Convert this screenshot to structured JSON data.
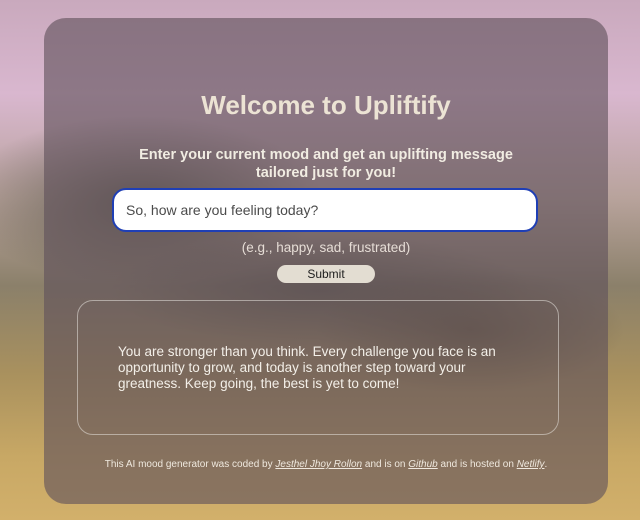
{
  "header": {
    "title": "Welcome to Upliftify",
    "subtitle": "Enter your current mood and get an uplifting message tailored just for you!"
  },
  "form": {
    "input_placeholder": "So, how are you feeling today?",
    "input_value": "",
    "hint": "(e.g., happy, sad, frustrated)",
    "submit_label": "Submit"
  },
  "result": {
    "message": "You are stronger than you think. Every challenge you face is an opportunity to grow, and today is another step toward your greatness. Keep going, the best is yet to come!"
  },
  "footer": {
    "text_1": "This AI mood generator was coded by ",
    "author_link": "Jesthel Jhoy Rollon",
    "text_2": " and is on ",
    "github_link": "Github",
    "text_3": " and is hosted on ",
    "netlify_link": "Netlify",
    "text_4": "."
  },
  "colors": {
    "card_background": "#5f505a",
    "input_border": "#1f3fb5",
    "title_text": "#ece3d4",
    "button_background": "#e3ddd2"
  }
}
